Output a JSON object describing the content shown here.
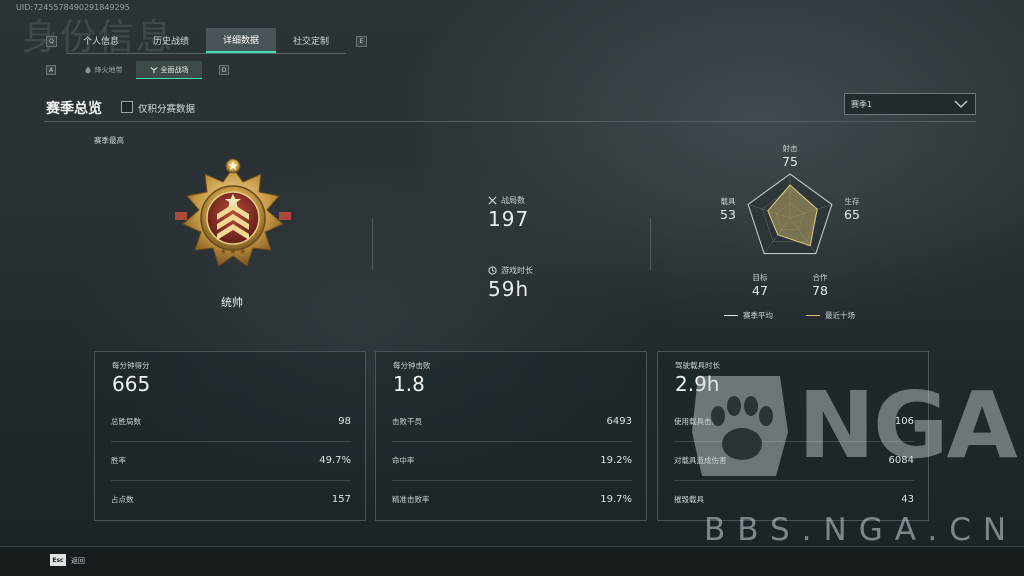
{
  "header": {
    "uid": "UID:7245578490291849295",
    "page_title_watermark": "身份信息",
    "tabs_left_key": "Q",
    "tabs_right_key": "E",
    "tabs": [
      {
        "label": "个人信息"
      },
      {
        "label": "历史战绩"
      },
      {
        "label": "详细数据",
        "active": true
      },
      {
        "label": "社交定制"
      }
    ],
    "subtabs_left_key": "A",
    "subtabs_right_key": "D",
    "subtabs": [
      {
        "label": "烽火地带"
      },
      {
        "label": "全面战场",
        "active": true
      }
    ]
  },
  "overview": {
    "title": "赛季总览",
    "ranked_only_label": "仅积分赛数据",
    "ranked_only_checked": false,
    "season_select": "赛季1"
  },
  "rank": {
    "label": "赛季最高",
    "name": "统帅"
  },
  "summary": {
    "matches_label": "战局数",
    "matches_value": "197",
    "playtime_label": "游戏时长",
    "playtime_value": "59h"
  },
  "radar": {
    "axes": [
      {
        "label": "射击",
        "value": "75",
        "score": 75
      },
      {
        "label": "生存",
        "value": "65",
        "score": 65
      },
      {
        "label": "合作",
        "value": "78",
        "score": 78
      },
      {
        "label": "目标",
        "value": "47",
        "score": 47
      },
      {
        "label": "载具",
        "value": "53",
        "score": 53
      }
    ],
    "legend_avg": "赛季平均",
    "legend_recent": "最近十场",
    "colors": {
      "avg": "#e6e9eb",
      "recent": "#d9c36a",
      "fill": "#b9a567"
    }
  },
  "cards": [
    {
      "header_label": "每分钟得分",
      "header_value": "665",
      "rows": [
        {
          "label": "总胜局数",
          "value": "98"
        },
        {
          "label": "胜率",
          "value": "49.7%"
        },
        {
          "label": "占点数",
          "value": "157"
        }
      ]
    },
    {
      "header_label": "每分钟击败",
      "header_value": "1.8",
      "rows": [
        {
          "label": "击败干员",
          "value": "6493"
        },
        {
          "label": "命中率",
          "value": "19.2%"
        },
        {
          "label": "精准击败率",
          "value": "19.7%"
        }
      ]
    },
    {
      "header_label": "驾驶载具时长",
      "header_value": "2.9h",
      "rows": [
        {
          "label": "使用载具击败",
          "value": "106"
        },
        {
          "label": "对载具造成伤害",
          "value": "6084"
        },
        {
          "label": "摧毁载具",
          "value": "43"
        }
      ]
    }
  ],
  "footer": {
    "esc_key": "Esc",
    "back_label": "返回"
  },
  "watermark": {
    "logo_text": "NGA",
    "url": "BBS.NGA.CN"
  },
  "icons": [
    "crossed-swords-icon",
    "clock-icon",
    "chevron-down-icon",
    "flame-icon",
    "battlefield-icon",
    "rank-medal-icon",
    "paw-logo-icon"
  ]
}
